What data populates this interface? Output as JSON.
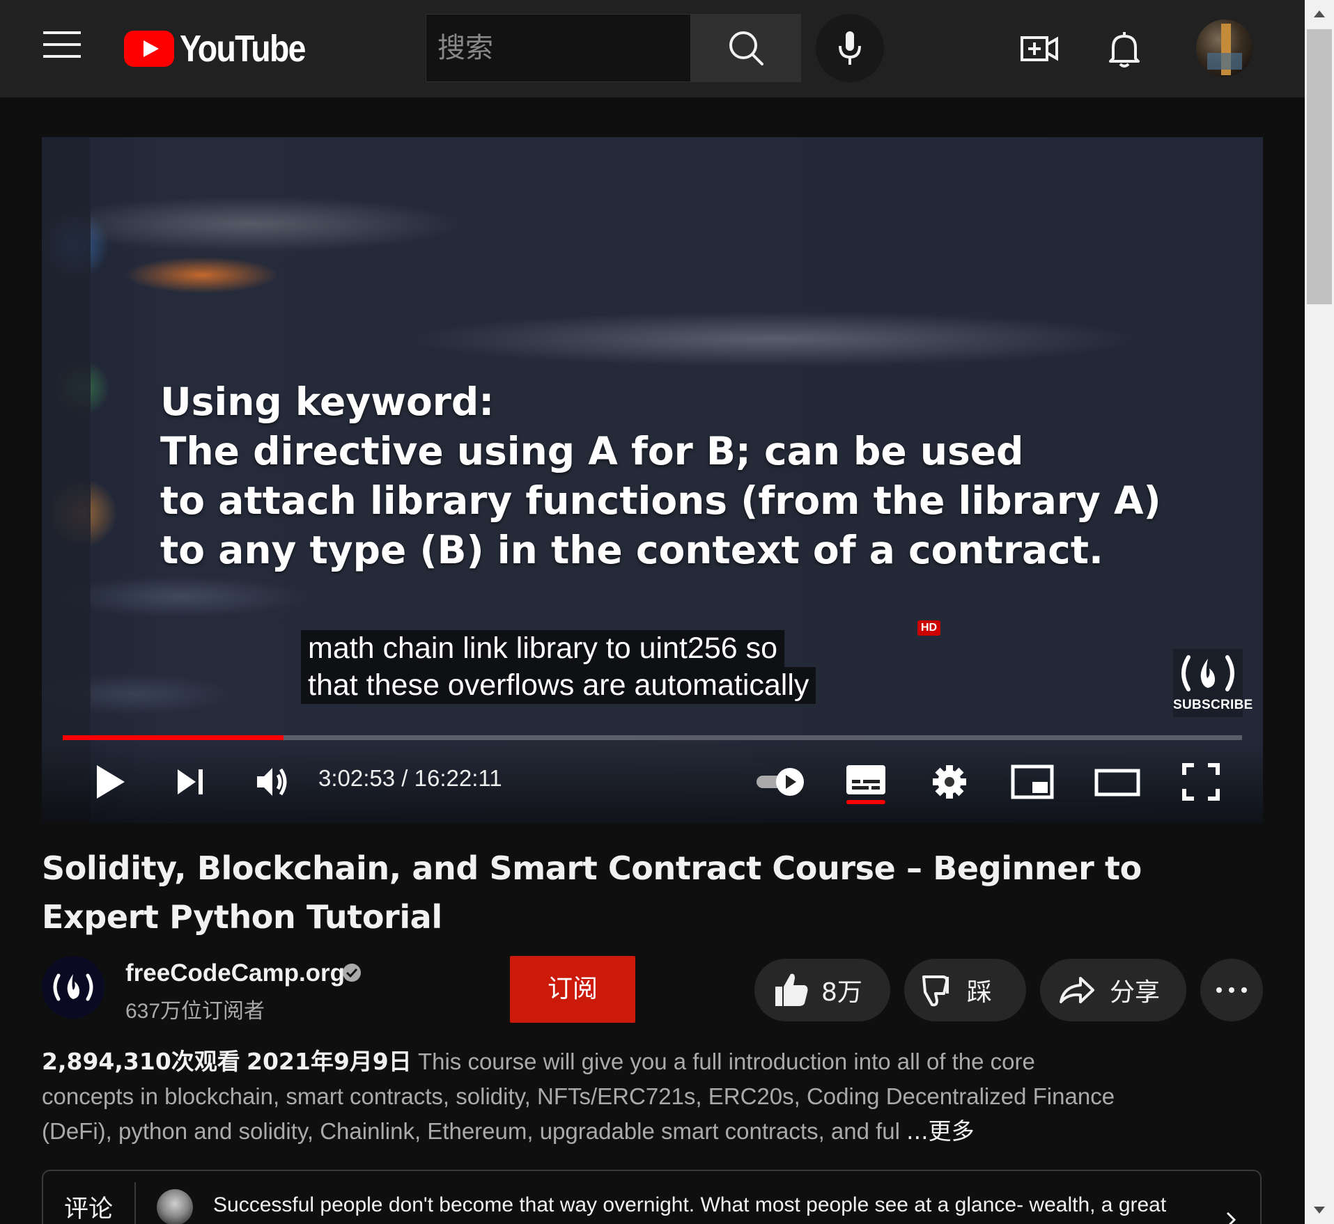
{
  "masthead": {
    "logo_text": "YouTube",
    "search_placeholder": "搜索",
    "icons": [
      "menu-icon",
      "search-icon",
      "mic-icon",
      "create-video-icon",
      "bell-icon",
      "avatar"
    ]
  },
  "player": {
    "overlay_lines": [
      "Using keyword:",
      "The directive using A for B; can be used",
      "to attach library functions (from the library A)",
      "to any type (B) in the context of a contract."
    ],
    "caption_lines": [
      "math chain link library to uint256 so",
      "that these overflows are automatically"
    ],
    "branding_label": "SUBSCRIBE",
    "time_current": "3:02:53",
    "time_total": "16:22:11",
    "time_display": "3:02:53 / 16:22:11",
    "progress_fraction": 0.187,
    "hd_badge": "HD",
    "autoplay_on": true,
    "subtitles_on": true,
    "colors": {
      "progress": "#ff0000",
      "subtitle_underline": "#ff0000"
    }
  },
  "video": {
    "title": "Solidity, Blockchain, and Smart Contract Course – Beginner to Expert Python Tutorial",
    "channel_name": "freeCodeCamp.org",
    "subscriber_count": "637万位订阅者",
    "subscribe_label": "订阅",
    "like_count": "8万",
    "dislike_label": "踩",
    "share_label": "分享",
    "views": "2,894,310次观看",
    "date": "2021年9月9日",
    "description": "This course will give you a full introduction into all of the core concepts in blockchain, smart contracts, solidity, NFTs/ERC721s, ERC20s, Coding Decentralized Finance (DeFi), python and solidity, Chainlink, Ethereum, upgradable smart contracts, and ful",
    "more_label": "...更多",
    "colors": {
      "subscribe": "#cc1a0a"
    }
  },
  "comments": {
    "label": "评论",
    "preview_text": "Successful people don't become that way overnight. What most people see at a glance- wealth, a great"
  }
}
